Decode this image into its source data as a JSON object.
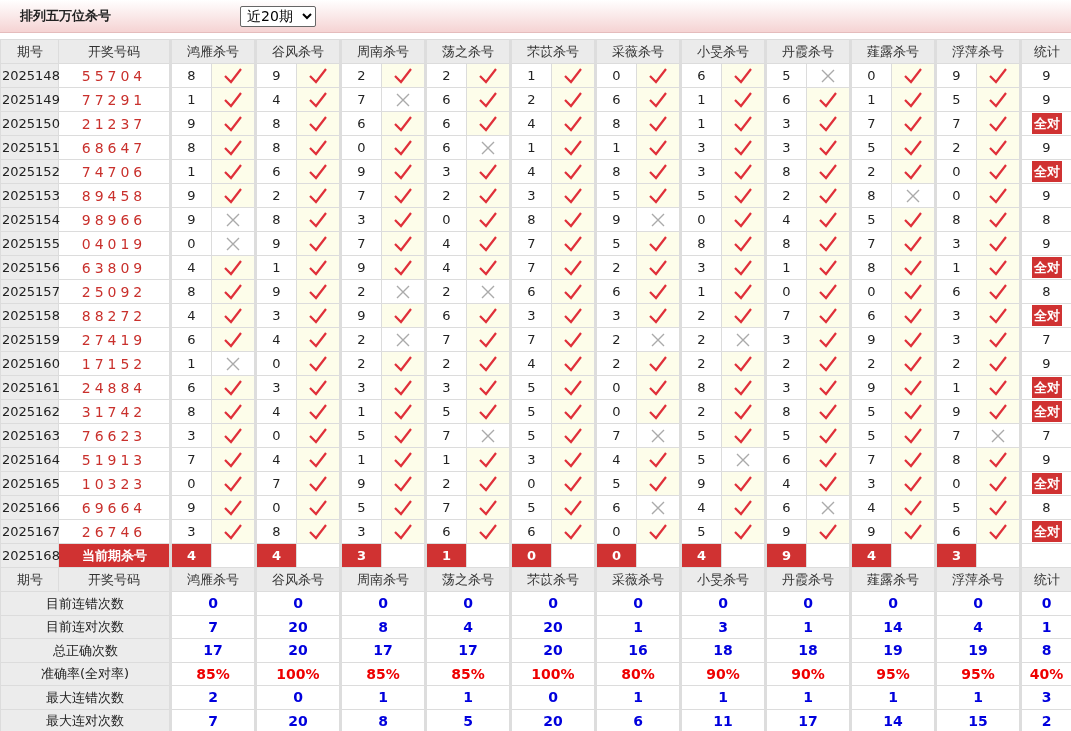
{
  "title": "排列五万位杀号",
  "period_select": {
    "value": "近20期"
  },
  "columns": [
    "期号",
    "开奖号码",
    "鸿雁杀号",
    "谷风杀号",
    "周南杀号",
    "荡之杀号",
    "芣苡杀号",
    "采薇杀号",
    "小旻杀号",
    "丹霞杀号",
    "薤露杀号",
    "浮萍杀号",
    "统计"
  ],
  "rows": [
    {
      "period": "2025148",
      "number": "55704",
      "kills": [
        {
          "kill": "8",
          "hit": true
        },
        {
          "kill": "9",
          "hit": true
        },
        {
          "kill": "2",
          "hit": true
        },
        {
          "kill": "2",
          "hit": true
        },
        {
          "kill": "1",
          "hit": true
        },
        {
          "kill": "0",
          "hit": true
        },
        {
          "kill": "6",
          "hit": true
        },
        {
          "kill": "5",
          "hit": false
        },
        {
          "kill": "0",
          "hit": true
        },
        {
          "kill": "9",
          "hit": true
        }
      ],
      "stat": "9",
      "all_correct": false
    },
    {
      "period": "2025149",
      "number": "77291",
      "kills": [
        {
          "kill": "1",
          "hit": true
        },
        {
          "kill": "4",
          "hit": true
        },
        {
          "kill": "7",
          "hit": false
        },
        {
          "kill": "6",
          "hit": true
        },
        {
          "kill": "2",
          "hit": true
        },
        {
          "kill": "6",
          "hit": true
        },
        {
          "kill": "1",
          "hit": true
        },
        {
          "kill": "6",
          "hit": true
        },
        {
          "kill": "1",
          "hit": true
        },
        {
          "kill": "5",
          "hit": true
        }
      ],
      "stat": "9",
      "all_correct": false
    },
    {
      "period": "2025150",
      "number": "21237",
      "kills": [
        {
          "kill": "9",
          "hit": true
        },
        {
          "kill": "8",
          "hit": true
        },
        {
          "kill": "6",
          "hit": true
        },
        {
          "kill": "6",
          "hit": true
        },
        {
          "kill": "4",
          "hit": true
        },
        {
          "kill": "8",
          "hit": true
        },
        {
          "kill": "1",
          "hit": true
        },
        {
          "kill": "3",
          "hit": true
        },
        {
          "kill": "7",
          "hit": true
        },
        {
          "kill": "7",
          "hit": true
        }
      ],
      "stat": "全对",
      "all_correct": true
    },
    {
      "period": "2025151",
      "number": "68647",
      "kills": [
        {
          "kill": "8",
          "hit": true
        },
        {
          "kill": "8",
          "hit": true
        },
        {
          "kill": "0",
          "hit": true
        },
        {
          "kill": "6",
          "hit": false
        },
        {
          "kill": "1",
          "hit": true
        },
        {
          "kill": "1",
          "hit": true
        },
        {
          "kill": "3",
          "hit": true
        },
        {
          "kill": "3",
          "hit": true
        },
        {
          "kill": "5",
          "hit": true
        },
        {
          "kill": "2",
          "hit": true
        }
      ],
      "stat": "9",
      "all_correct": false
    },
    {
      "period": "2025152",
      "number": "74706",
      "kills": [
        {
          "kill": "1",
          "hit": true
        },
        {
          "kill": "6",
          "hit": true
        },
        {
          "kill": "9",
          "hit": true
        },
        {
          "kill": "3",
          "hit": true
        },
        {
          "kill": "4",
          "hit": true
        },
        {
          "kill": "8",
          "hit": true
        },
        {
          "kill": "3",
          "hit": true
        },
        {
          "kill": "8",
          "hit": true
        },
        {
          "kill": "2",
          "hit": true
        },
        {
          "kill": "0",
          "hit": true
        }
      ],
      "stat": "全对",
      "all_correct": true
    },
    {
      "period": "2025153",
      "number": "89458",
      "kills": [
        {
          "kill": "9",
          "hit": true
        },
        {
          "kill": "2",
          "hit": true
        },
        {
          "kill": "7",
          "hit": true
        },
        {
          "kill": "2",
          "hit": true
        },
        {
          "kill": "3",
          "hit": true
        },
        {
          "kill": "5",
          "hit": true
        },
        {
          "kill": "5",
          "hit": true
        },
        {
          "kill": "2",
          "hit": true
        },
        {
          "kill": "8",
          "hit": false
        },
        {
          "kill": "0",
          "hit": true
        }
      ],
      "stat": "9",
      "all_correct": false
    },
    {
      "period": "2025154",
      "number": "98966",
      "kills": [
        {
          "kill": "9",
          "hit": false
        },
        {
          "kill": "8",
          "hit": true
        },
        {
          "kill": "3",
          "hit": true
        },
        {
          "kill": "0",
          "hit": true
        },
        {
          "kill": "8",
          "hit": true
        },
        {
          "kill": "9",
          "hit": false
        },
        {
          "kill": "0",
          "hit": true
        },
        {
          "kill": "4",
          "hit": true
        },
        {
          "kill": "5",
          "hit": true
        },
        {
          "kill": "8",
          "hit": true
        }
      ],
      "stat": "8",
      "all_correct": false
    },
    {
      "period": "2025155",
      "number": "04019",
      "kills": [
        {
          "kill": "0",
          "hit": false
        },
        {
          "kill": "9",
          "hit": true
        },
        {
          "kill": "7",
          "hit": true
        },
        {
          "kill": "4",
          "hit": true
        },
        {
          "kill": "7",
          "hit": true
        },
        {
          "kill": "5",
          "hit": true
        },
        {
          "kill": "8",
          "hit": true
        },
        {
          "kill": "8",
          "hit": true
        },
        {
          "kill": "7",
          "hit": true
        },
        {
          "kill": "3",
          "hit": true
        }
      ],
      "stat": "9",
      "all_correct": false
    },
    {
      "period": "2025156",
      "number": "63809",
      "kills": [
        {
          "kill": "4",
          "hit": true
        },
        {
          "kill": "1",
          "hit": true
        },
        {
          "kill": "9",
          "hit": true
        },
        {
          "kill": "4",
          "hit": true
        },
        {
          "kill": "7",
          "hit": true
        },
        {
          "kill": "2",
          "hit": true
        },
        {
          "kill": "3",
          "hit": true
        },
        {
          "kill": "1",
          "hit": true
        },
        {
          "kill": "8",
          "hit": true
        },
        {
          "kill": "1",
          "hit": true
        }
      ],
      "stat": "全对",
      "all_correct": true
    },
    {
      "period": "2025157",
      "number": "25092",
      "kills": [
        {
          "kill": "8",
          "hit": true
        },
        {
          "kill": "9",
          "hit": true
        },
        {
          "kill": "2",
          "hit": false
        },
        {
          "kill": "2",
          "hit": false
        },
        {
          "kill": "6",
          "hit": true
        },
        {
          "kill": "6",
          "hit": true
        },
        {
          "kill": "1",
          "hit": true
        },
        {
          "kill": "0",
          "hit": true
        },
        {
          "kill": "0",
          "hit": true
        },
        {
          "kill": "6",
          "hit": true
        }
      ],
      "stat": "8",
      "all_correct": false
    },
    {
      "period": "2025158",
      "number": "88272",
      "kills": [
        {
          "kill": "4",
          "hit": true
        },
        {
          "kill": "3",
          "hit": true
        },
        {
          "kill": "9",
          "hit": true
        },
        {
          "kill": "6",
          "hit": true
        },
        {
          "kill": "3",
          "hit": true
        },
        {
          "kill": "3",
          "hit": true
        },
        {
          "kill": "2",
          "hit": true
        },
        {
          "kill": "7",
          "hit": true
        },
        {
          "kill": "6",
          "hit": true
        },
        {
          "kill": "3",
          "hit": true
        }
      ],
      "stat": "全对",
      "all_correct": true
    },
    {
      "period": "2025159",
      "number": "27419",
      "kills": [
        {
          "kill": "6",
          "hit": true
        },
        {
          "kill": "4",
          "hit": true
        },
        {
          "kill": "2",
          "hit": false
        },
        {
          "kill": "7",
          "hit": true
        },
        {
          "kill": "7",
          "hit": true
        },
        {
          "kill": "2",
          "hit": false
        },
        {
          "kill": "2",
          "hit": false
        },
        {
          "kill": "3",
          "hit": true
        },
        {
          "kill": "9",
          "hit": true
        },
        {
          "kill": "3",
          "hit": true
        }
      ],
      "stat": "7",
      "all_correct": false
    },
    {
      "period": "2025160",
      "number": "17152",
      "kills": [
        {
          "kill": "1",
          "hit": false
        },
        {
          "kill": "0",
          "hit": true
        },
        {
          "kill": "2",
          "hit": true
        },
        {
          "kill": "2",
          "hit": true
        },
        {
          "kill": "4",
          "hit": true
        },
        {
          "kill": "2",
          "hit": true
        },
        {
          "kill": "2",
          "hit": true
        },
        {
          "kill": "2",
          "hit": true
        },
        {
          "kill": "2",
          "hit": true
        },
        {
          "kill": "2",
          "hit": true
        }
      ],
      "stat": "9",
      "all_correct": false
    },
    {
      "period": "2025161",
      "number": "24884",
      "kills": [
        {
          "kill": "6",
          "hit": true
        },
        {
          "kill": "3",
          "hit": true
        },
        {
          "kill": "3",
          "hit": true
        },
        {
          "kill": "3",
          "hit": true
        },
        {
          "kill": "5",
          "hit": true
        },
        {
          "kill": "0",
          "hit": true
        },
        {
          "kill": "8",
          "hit": true
        },
        {
          "kill": "3",
          "hit": true
        },
        {
          "kill": "9",
          "hit": true
        },
        {
          "kill": "1",
          "hit": true
        }
      ],
      "stat": "全对",
      "all_correct": true
    },
    {
      "period": "2025162",
      "number": "31742",
      "kills": [
        {
          "kill": "8",
          "hit": true
        },
        {
          "kill": "4",
          "hit": true
        },
        {
          "kill": "1",
          "hit": true
        },
        {
          "kill": "5",
          "hit": true
        },
        {
          "kill": "5",
          "hit": true
        },
        {
          "kill": "0",
          "hit": true
        },
        {
          "kill": "2",
          "hit": true
        },
        {
          "kill": "8",
          "hit": true
        },
        {
          "kill": "5",
          "hit": true
        },
        {
          "kill": "9",
          "hit": true
        }
      ],
      "stat": "全对",
      "all_correct": true
    },
    {
      "period": "2025163",
      "number": "76623",
      "kills": [
        {
          "kill": "3",
          "hit": true
        },
        {
          "kill": "0",
          "hit": true
        },
        {
          "kill": "5",
          "hit": true
        },
        {
          "kill": "7",
          "hit": false
        },
        {
          "kill": "5",
          "hit": true
        },
        {
          "kill": "7",
          "hit": false
        },
        {
          "kill": "5",
          "hit": true
        },
        {
          "kill": "5",
          "hit": true
        },
        {
          "kill": "5",
          "hit": true
        },
        {
          "kill": "7",
          "hit": false
        }
      ],
      "stat": "7",
      "all_correct": false
    },
    {
      "period": "2025164",
      "number": "51913",
      "kills": [
        {
          "kill": "7",
          "hit": true
        },
        {
          "kill": "4",
          "hit": true
        },
        {
          "kill": "1",
          "hit": true
        },
        {
          "kill": "1",
          "hit": true
        },
        {
          "kill": "3",
          "hit": true
        },
        {
          "kill": "4",
          "hit": true
        },
        {
          "kill": "5",
          "hit": false
        },
        {
          "kill": "6",
          "hit": true
        },
        {
          "kill": "7",
          "hit": true
        },
        {
          "kill": "8",
          "hit": true
        }
      ],
      "stat": "9",
      "all_correct": false
    },
    {
      "period": "2025165",
      "number": "10323",
      "kills": [
        {
          "kill": "0",
          "hit": true
        },
        {
          "kill": "7",
          "hit": true
        },
        {
          "kill": "9",
          "hit": true
        },
        {
          "kill": "2",
          "hit": true
        },
        {
          "kill": "0",
          "hit": true
        },
        {
          "kill": "5",
          "hit": true
        },
        {
          "kill": "9",
          "hit": true
        },
        {
          "kill": "4",
          "hit": true
        },
        {
          "kill": "3",
          "hit": true
        },
        {
          "kill": "0",
          "hit": true
        }
      ],
      "stat": "全对",
      "all_correct": true
    },
    {
      "period": "2025166",
      "number": "69664",
      "kills": [
        {
          "kill": "9",
          "hit": true
        },
        {
          "kill": "0",
          "hit": true
        },
        {
          "kill": "5",
          "hit": true
        },
        {
          "kill": "7",
          "hit": true
        },
        {
          "kill": "5",
          "hit": true
        },
        {
          "kill": "6",
          "hit": false
        },
        {
          "kill": "4",
          "hit": true
        },
        {
          "kill": "6",
          "hit": false
        },
        {
          "kill": "4",
          "hit": true
        },
        {
          "kill": "5",
          "hit": true
        }
      ],
      "stat": "8",
      "all_correct": false
    },
    {
      "period": "2025167",
      "number": "26746",
      "kills": [
        {
          "kill": "3",
          "hit": true
        },
        {
          "kill": "8",
          "hit": true
        },
        {
          "kill": "3",
          "hit": true
        },
        {
          "kill": "6",
          "hit": true
        },
        {
          "kill": "6",
          "hit": true
        },
        {
          "kill": "0",
          "hit": true
        },
        {
          "kill": "5",
          "hit": true
        },
        {
          "kill": "9",
          "hit": true
        },
        {
          "kill": "9",
          "hit": true
        },
        {
          "kill": "6",
          "hit": true
        }
      ],
      "stat": "全对",
      "all_correct": true
    }
  ],
  "current": {
    "period": "2025168",
    "label": "当前期杀号",
    "kills": [
      "4",
      "4",
      "3",
      "1",
      "0",
      "0",
      "4",
      "9",
      "4",
      "3"
    ]
  },
  "footer_columns": [
    "期号",
    "开奖号码",
    "鸿雁杀号",
    "谷风杀号",
    "周南杀号",
    "荡之杀号",
    "芣苡杀号",
    "采薇杀号",
    "小旻杀号",
    "丹霞杀号",
    "薤露杀号",
    "浮萍杀号",
    "统计"
  ],
  "stats": [
    {
      "label": "目前连错次数",
      "kind": "count",
      "values": [
        "0",
        "0",
        "0",
        "0",
        "0",
        "0",
        "0",
        "0",
        "0",
        "0",
        "0"
      ]
    },
    {
      "label": "目前连对次数",
      "kind": "count",
      "values": [
        "7",
        "20",
        "8",
        "4",
        "20",
        "1",
        "3",
        "1",
        "14",
        "4",
        "1"
      ]
    },
    {
      "label": "总正确次数",
      "kind": "count",
      "values": [
        "17",
        "20",
        "17",
        "17",
        "20",
        "16",
        "18",
        "18",
        "19",
        "19",
        "8"
      ]
    },
    {
      "label": "准确率(全对率)",
      "kind": "rate",
      "values": [
        "85%",
        "100%",
        "85%",
        "85%",
        "100%",
        "80%",
        "90%",
        "90%",
        "95%",
        "95%",
        "40%"
      ]
    },
    {
      "label": "最大连错次数",
      "kind": "count",
      "values": [
        "2",
        "0",
        "1",
        "1",
        "0",
        "1",
        "1",
        "1",
        "1",
        "1",
        "3"
      ]
    },
    {
      "label": "最大连对次数",
      "kind": "count",
      "values": [
        "7",
        "20",
        "8",
        "5",
        "20",
        "6",
        "11",
        "17",
        "14",
        "15",
        "2"
      ]
    }
  ]
}
